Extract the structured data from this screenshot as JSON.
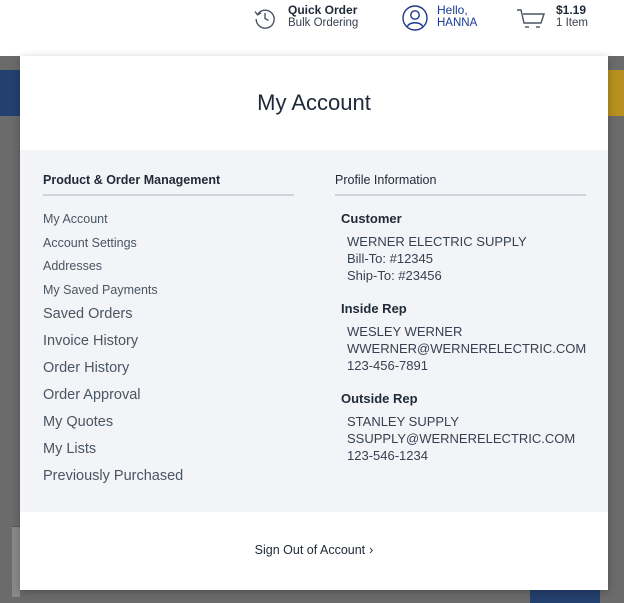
{
  "header": {
    "quick_order": {
      "title": "Quick Order",
      "subtitle": "Bulk Ordering",
      "icon": "history-clock-icon"
    },
    "account": {
      "greeting": "Hello,",
      "name": "HANNA",
      "icon": "user-circle-icon",
      "color": "#1e3a8a"
    },
    "cart": {
      "total": "$1.19",
      "count": "1 Item",
      "icon": "cart-icon"
    }
  },
  "panel": {
    "title": "My Account",
    "left": {
      "heading": "Product & Order Management",
      "links_small": [
        "My Account",
        "Account Settings",
        "Addresses",
        "My Saved Payments"
      ],
      "links_large": [
        "Saved Orders",
        "Invoice History",
        "Order History",
        "Order Approval",
        "My Quotes",
        "My Lists",
        "Previously Purchased"
      ]
    },
    "right": {
      "heading": "Profile Information",
      "customer": {
        "title": "Customer",
        "name": "WERNER ELECTRIC SUPPLY",
        "bill_to": "Bill-To: #12345",
        "ship_to": "Ship-To: #23456"
      },
      "inside_rep": {
        "title": "Inside Rep",
        "name": "WESLEY WERNER",
        "email": "WWERNER@WERNERELECTRIC.COM",
        "phone": "123-456-7891"
      },
      "outside_rep": {
        "title": "Outside Rep",
        "name": "STANLEY SUPPLY",
        "email": "SSUPPLY@WERNERELECTRIC.COM",
        "phone": "123-546-1234"
      }
    },
    "signout": {
      "label": "Sign Out of Account",
      "chevron": "›"
    }
  },
  "colors": {
    "panel_body_bg": "#f2f4f7",
    "nav_blue": "#24406f",
    "nav_gold": "#b89020",
    "overlay": "#6b6b6b"
  }
}
